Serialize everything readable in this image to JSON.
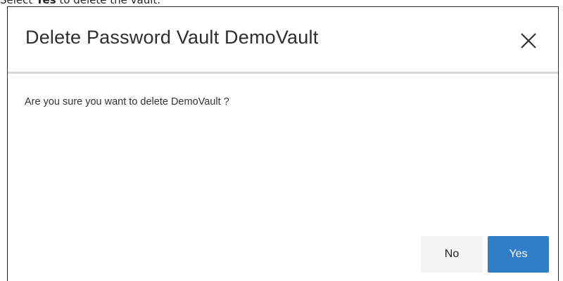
{
  "caption": {
    "prefix": "Select ",
    "bold": "Yes",
    "suffix": " to delete the vault."
  },
  "dialog": {
    "title": "Delete Password Vault DemoVault",
    "close_icon": "close-icon",
    "message": "Are you sure you want to delete DemoVault ?",
    "buttons": {
      "no_label": "No",
      "yes_label": "Yes"
    }
  },
  "colors": {
    "primary_button": "#2f7ec7",
    "secondary_button": "#f3f3f3",
    "header_divider": "#d6d6d6"
  }
}
